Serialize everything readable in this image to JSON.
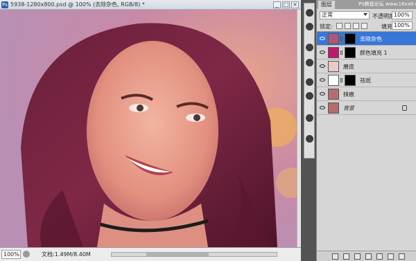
{
  "document": {
    "title": "5938-1280x800.psd @ 100% (去除杂色, RGB/8) *",
    "app_icon": "Ps",
    "zoom": "100%",
    "doc_info": "文档:1.49M/8.40M",
    "window_buttons": [
      "_",
      "□",
      "×"
    ]
  },
  "layers_panel": {
    "tab_label": "图层",
    "watermark": "PS教程论坛 www.16xx8.com",
    "blend_mode": "正常",
    "opacity_label": "不透明度:",
    "opacity_value": "100%",
    "lock_label": "锁定:",
    "fill_label": "填充:",
    "fill_value": "100%",
    "layers": [
      {
        "name": "去除杂色",
        "selected": true,
        "thumb_color": "#a8587a",
        "has_mask": true
      },
      {
        "name": "颜色填充 1",
        "selected": false,
        "thumb_color": "#c0186a",
        "has_mask": true
      },
      {
        "name": "磨皮",
        "selected": false,
        "thumb_color": "#e9c9c9",
        "has_mask": false
      },
      {
        "name": "祛斑",
        "selected": false,
        "thumb_color": "#ffffff",
        "has_mask": true
      },
      {
        "name": "抹痕",
        "selected": false,
        "thumb_color": "#b86d6f",
        "has_mask": false
      },
      {
        "name": "背景",
        "selected": false,
        "thumb_color": "#b46b6a",
        "has_mask": false,
        "locked": true
      }
    ]
  },
  "colors": {
    "selected_layer": "#3876d8",
    "canvas_tint": "#c9a5bf"
  }
}
